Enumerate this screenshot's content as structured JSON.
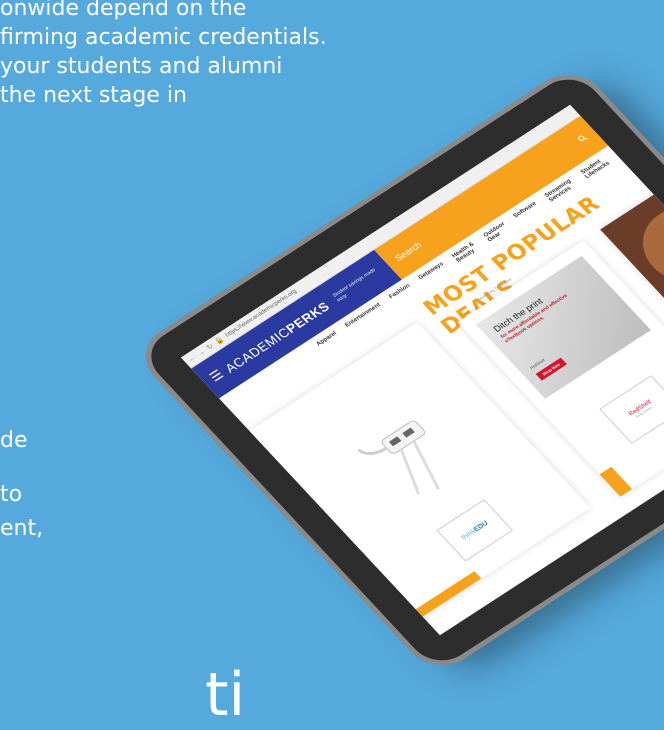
{
  "background_text": {
    "lines": [
      "onwide depend on the",
      "firming academic credentials.",
      "your students and alumni",
      "the next stage in"
    ],
    "fragments": [
      "de",
      "to",
      "ent,"
    ],
    "bottom_fragment": "ti"
  },
  "browser": {
    "url": "https://www.academicperks.org"
  },
  "site": {
    "brand_prefix": "ACADEMIC",
    "brand_bold": "PERKS",
    "tagline": "Student savings made easy.",
    "search_placeholder": "Search",
    "categories": [
      "Apparel",
      "Entertainment",
      "Fashion",
      "Getaways",
      "Health & Beauty",
      "Outdoor Gear",
      "Software",
      "Streaming Services",
      "Student Lifehacks"
    ],
    "section_title": "MOST POPULAR DEALS",
    "disclosure": "Advertising Disclosure",
    "deals": {
      "left_logo_prefix": "think",
      "left_logo_suffix": "EDU",
      "mid_ad_title": "Ditch the print",
      "mid_ad_sub": "for more affordable and effective eTextbook options.",
      "mid_ad_brand": "RedShelf",
      "mid_ad_button": "Shop Now",
      "mid_logo": "RedShelf",
      "mid_logo_sub": "Study smarter"
    }
  },
  "colors": {
    "brand_blue": "#2b3aa0",
    "accent_orange": "#f7a21c",
    "page_blue": "#55a9dc"
  }
}
